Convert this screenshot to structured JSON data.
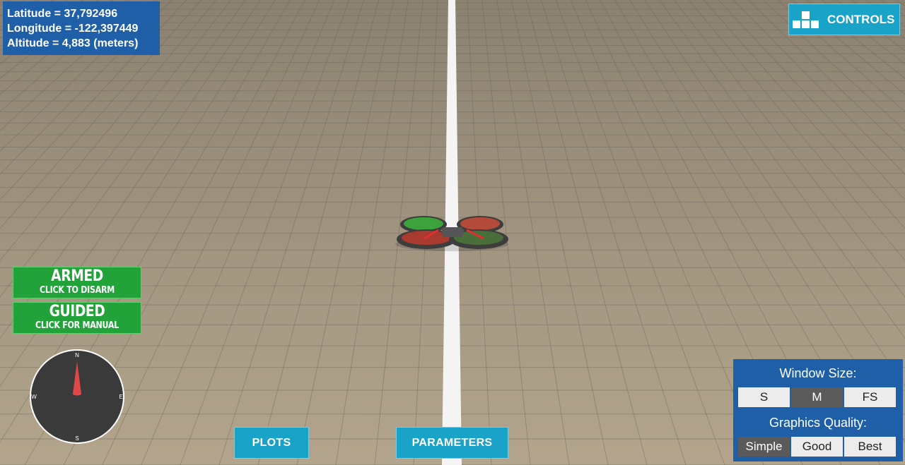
{
  "telemetry": {
    "latitude": "Latitude = 37,792496",
    "longitude": "Longitude = -122,397449",
    "altitude": "Altitude = 4,883 (meters)"
  },
  "controls_button": {
    "label": "CONTROLS",
    "icon": "keyboard-keys-icon"
  },
  "arm_button": {
    "title": "ARMED",
    "subtitle": "CLICK TO DISARM",
    "color": "#22a339"
  },
  "mode_button": {
    "title": "GUIDED",
    "subtitle": "CLICK FOR MANUAL",
    "color": "#22a339"
  },
  "compass": {
    "north": "N",
    "south": "S",
    "east": "E",
    "west": "W",
    "icon": "compass-needle-icon"
  },
  "bottom_buttons": {
    "plots": "PLOTS",
    "parameters": "PARAMETERS"
  },
  "settings": {
    "window_size_label": "Window Size:",
    "window_sizes": [
      "S",
      "M",
      "FS"
    ],
    "window_size_selected": "M",
    "graphics_quality_label": "Graphics Quality:",
    "graphics_qualities": [
      "Simple",
      "Good",
      "Best"
    ],
    "graphics_quality_selected": "Simple"
  },
  "colors": {
    "panel_blue": "#1f5fa8",
    "button_cyan": "#1aa3c8",
    "status_green": "#22a339",
    "ground": "#9c9078",
    "center_line": "#ffffff"
  }
}
